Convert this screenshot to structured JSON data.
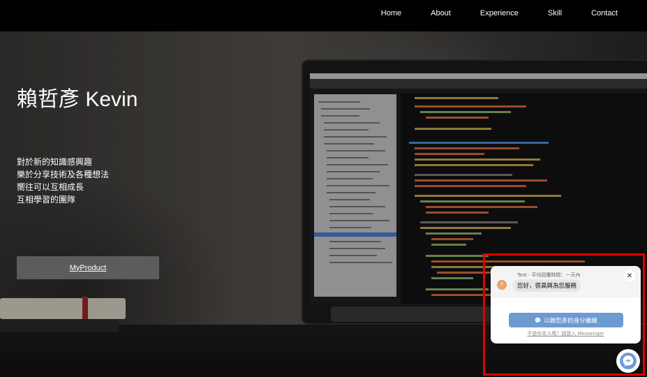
{
  "nav": {
    "items": [
      {
        "label": "Home"
      },
      {
        "label": "About"
      },
      {
        "label": "Experience"
      },
      {
        "label": "Skill"
      },
      {
        "label": "Contact"
      }
    ]
  },
  "hero": {
    "title": "賴哲彥 Kevin",
    "taglines": [
      "對於新的知識感興趣",
      "樂於分享技術及各種想法",
      "嚮往可以互相成長",
      "互相學習的團隊"
    ],
    "cta_label": "MyProduct"
  },
  "chat": {
    "meta": "Test · 平均回覆時間：一天內",
    "avatar_letter": "T",
    "greeting": "您好，很高興為您服務",
    "continue_label": "以賴哲彥的身分繼續",
    "not_you_label": "不是你本人嗎？請登入 Messenger",
    "close_icon": "close-icon",
    "messenger_icon": "messenger-icon"
  },
  "colors": {
    "nav_bg": "#000000",
    "cta_bg": "#5c5c5c",
    "messenger_blue": "#6d9ad2",
    "highlight": "#e00000"
  }
}
